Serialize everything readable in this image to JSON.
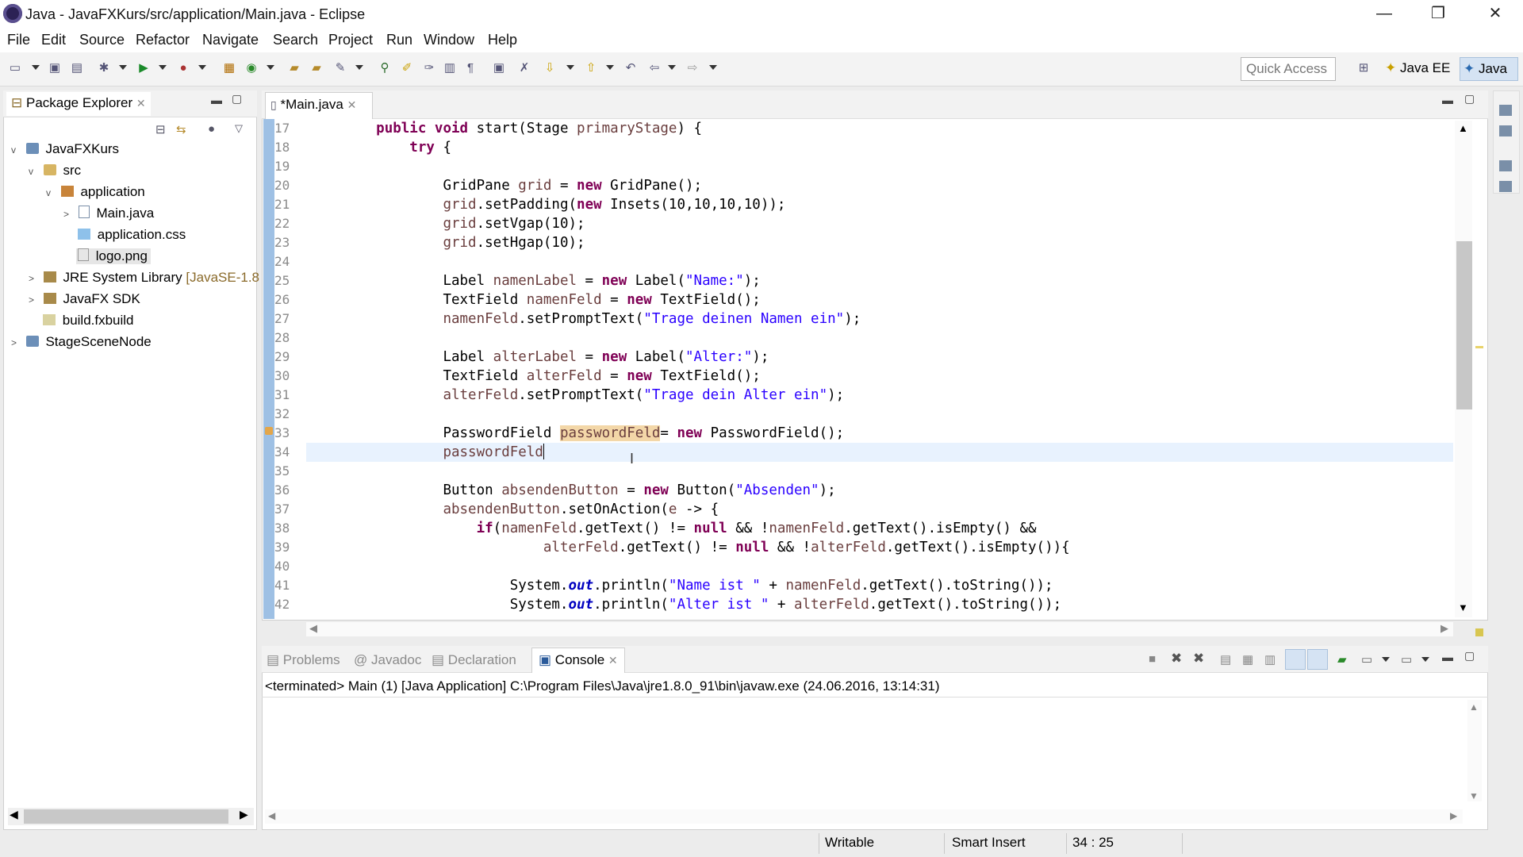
{
  "window": {
    "title": "Java - JavaFXKurs/src/application/Main.java - Eclipse",
    "minimize": "—",
    "restore": "❐",
    "close": "✕"
  },
  "menu": [
    "File",
    "Edit",
    "Source",
    "Refactor",
    "Navigate",
    "Search",
    "Project",
    "Run",
    "Window",
    "Help"
  ],
  "toolbar": {
    "quick_access_placeholder": "Quick Access",
    "perspective_javaee": "Java EE",
    "perspective_java": "Java"
  },
  "package_explorer": {
    "title": "Package Explorer",
    "tree": [
      {
        "label": "JavaFXKurs",
        "arrow": "v"
      },
      {
        "label": "src",
        "arrow": "v"
      },
      {
        "label": "application",
        "arrow": "v"
      },
      {
        "label": "Main.java",
        "arrow": ">"
      },
      {
        "label": "application.css",
        "arrow": ""
      },
      {
        "label": "logo.png",
        "arrow": ""
      },
      {
        "label": "JRE System Library",
        "suffix": "[JavaSE-1.8",
        "arrow": ">"
      },
      {
        "label": "JavaFX SDK",
        "arrow": ">"
      },
      {
        "label": "build.fxbuild",
        "arrow": ""
      },
      {
        "label": "StageSceneNode",
        "arrow": ">"
      }
    ]
  },
  "editor": {
    "tab_label": "*Main.java",
    "line_numbers": [
      "17",
      "18",
      "19",
      "20",
      "21",
      "22",
      "23",
      "24",
      "25",
      "26",
      "27",
      "28",
      "29",
      "30",
      "31",
      "32",
      "33",
      "34",
      "35",
      "36",
      "37",
      "38",
      "39",
      "40",
      "41",
      "42"
    ],
    "code": {
      "l17a": "public void",
      "l17b": " start(Stage ",
      "l17c": "primaryStage",
      "l17d": ") {",
      "l18a": "try",
      "l18b": " {",
      "l20a": "GridPane ",
      "l20b": "grid",
      "l20c": " = ",
      "l20d": "new",
      "l20e": " GridPane();",
      "l21a": "grid",
      "l21b": ".setPadding(",
      "l21c": "new",
      "l21d": " Insets(10,10,10,10));",
      "l22a": "grid",
      "l22b": ".setVgap(10);",
      "l23a": "grid",
      "l23b": ".setHgap(10);",
      "l25a": "Label ",
      "l25b": "namenLabel",
      "l25c": " = ",
      "l25d": "new",
      "l25e": " Label(",
      "l25f": "\"Name:\"",
      "l25g": ");",
      "l26a": "TextField ",
      "l26b": "namenFeld",
      "l26c": " = ",
      "l26d": "new",
      "l26e": " TextField();",
      "l27a": "namenFeld",
      "l27b": ".setPromptText(",
      "l27c": "\"Trage deinen Namen ein\"",
      "l27d": ");",
      "l29a": "Label ",
      "l29b": "alterLabel",
      "l29c": " = ",
      "l29d": "new",
      "l29e": " Label(",
      "l29f": "\"Alter:\"",
      "l29g": ");",
      "l30a": "TextField ",
      "l30b": "alterFeld",
      "l30c": " = ",
      "l30d": "new",
      "l30e": " TextField();",
      "l31a": "alterFeld",
      "l31b": ".setPromptText(",
      "l31c": "\"Trage dein Alter ein\"",
      "l31d": ");",
      "l33a": "PasswordField ",
      "l33b": "passwordFeld",
      "l33c": "= ",
      "l33d": "new",
      "l33e": " PasswordField();",
      "l34a": "passwordFeld",
      "l36a": "Button ",
      "l36b": "absendenButton",
      "l36c": " = ",
      "l36d": "new",
      "l36e": " Button(",
      "l36f": "\"Absenden\"",
      "l36g": ");",
      "l37a": "absendenButton",
      "l37b": ".setOnAction(",
      "l37c": "e",
      "l37d": " -> {",
      "l38a": "if",
      "l38b": "(",
      "l38c": "namenFeld",
      "l38d": ".getText() != ",
      "l38e": "null",
      "l38f": " && !",
      "l38g": "namenFeld",
      "l38h": ".getText().isEmpty() &&",
      "l39a": "alterFeld",
      "l39b": ".getText() != ",
      "l39c": "null",
      "l39d": " && !",
      "l39e": "alterFeld",
      "l39f": ".getText().isEmpty()){",
      "l41a": "System.",
      "l41b": "out",
      "l41c": ".println(",
      "l41d": "\"Name ist \"",
      "l41e": " + ",
      "l41f": "namenFeld",
      "l41g": ".getText().toString());",
      "l42a": "System.",
      "l42b": "out",
      "l42c": ".println(",
      "l42d": "\"Alter ist \"",
      "l42e": " + ",
      "l42f": "alterFeld",
      "l42g": ".getText().toString());"
    }
  },
  "bottom_panel": {
    "tabs": [
      "Problems",
      "Javadoc",
      "Declaration",
      "Console"
    ],
    "console_output": "<terminated> Main (1) [Java Application] C:\\Program Files\\Java\\jre1.8.0_91\\bin\\javaw.exe (24.06.2016, 13:14:31)"
  },
  "status_bar": {
    "writable": "Writable",
    "insert_mode": "Smart Insert",
    "position": "34 : 25"
  }
}
